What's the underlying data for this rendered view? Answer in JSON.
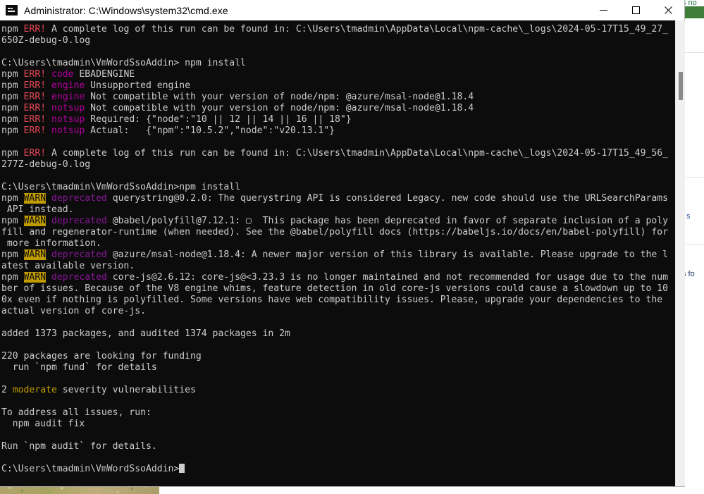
{
  "window": {
    "title": "Administrator:  C:\\Windows\\system32\\cmd.exe",
    "icon": "cmd-icon",
    "minimize_label": "Minimize",
    "maximize_label": "Maximize",
    "close_label": "Close",
    "background_color": "#0c0c0c",
    "text_color": "#cccccc"
  },
  "colors": {
    "error": "#e74856",
    "error_keyword": "#b4009e",
    "warn_background": "#c19c00",
    "deprecated": "#881798",
    "yellow": "#c19c00",
    "foreground": "#cccccc",
    "excel_green": "#217346"
  },
  "background_app": {
    "name": "excel-window",
    "ribbon_title": "s no",
    "cell_text_1": "s",
    "cell_text_2": "s fo"
  },
  "terminal": {
    "prompt_1": "C:\\Users\\tmadmin\\VmWordSsoAddin> npm install",
    "prompt_2": "C:\\Users\\tmadmin\\VmWordSsoAddin>npm install",
    "prompt_final": "C:\\Users\\tmadmin\\VmWordSsoAddin>",
    "cursor": "block-cursor",
    "lines": [
      {
        "type": "err",
        "prefix": "npm ",
        "tag": "ERR!",
        "keyword": "",
        "text": " A complete log of this run can be found in: C:\\Users\\tmadmin\\AppData\\Local\\npm-cache\\_logs\\2024-05-17T15_49_27_"
      },
      {
        "type": "plain",
        "text": "650Z-debug-0.log"
      },
      {
        "type": "blank",
        "text": ""
      },
      {
        "type": "prompt",
        "text": "C:\\Users\\tmadmin\\VmWordSsoAddin> npm install"
      },
      {
        "type": "err",
        "prefix": "npm ",
        "tag": "ERR!",
        "keyword": "code",
        "text": " EBADENGINE"
      },
      {
        "type": "err",
        "prefix": "npm ",
        "tag": "ERR!",
        "keyword": "engine",
        "text": " Unsupported engine"
      },
      {
        "type": "err",
        "prefix": "npm ",
        "tag": "ERR!",
        "keyword": "engine",
        "text": " Not compatible with your version of node/npm: @azure/msal-node@1.18.4"
      },
      {
        "type": "err",
        "prefix": "npm ",
        "tag": "ERR!",
        "keyword": "notsup",
        "text": " Not compatible with your version of node/npm: @azure/msal-node@1.18.4"
      },
      {
        "type": "err",
        "prefix": "npm ",
        "tag": "ERR!",
        "keyword": "notsup",
        "text": " Required: {\"node\":\"10 || 12 || 14 || 16 || 18\"}"
      },
      {
        "type": "err",
        "prefix": "npm ",
        "tag": "ERR!",
        "keyword": "notsup",
        "text": " Actual:   {\"npm\":\"10.5.2\",\"node\":\"v20.13.1\"}"
      },
      {
        "type": "blank",
        "text": ""
      },
      {
        "type": "err",
        "prefix": "npm ",
        "tag": "ERR!",
        "keyword": "",
        "text": " A complete log of this run can be found in: C:\\Users\\tmadmin\\AppData\\Local\\npm-cache\\_logs\\2024-05-17T15_49_56_"
      },
      {
        "type": "plain",
        "text": "277Z-debug-0.log"
      },
      {
        "type": "blank",
        "text": ""
      },
      {
        "type": "prompt",
        "text": "C:\\Users\\tmadmin\\VmWordSsoAddin>npm install"
      },
      {
        "type": "warn",
        "prefix": "npm ",
        "tag": "WARN",
        "keyword": "deprecated",
        "text": " querystring@0.2.0: The querystring API is considered Legacy. new code should use the URLSearchParams"
      },
      {
        "type": "plain",
        "text": " API instead."
      },
      {
        "type": "warn",
        "prefix": "npm ",
        "tag": "WARN",
        "keyword": "deprecated",
        "text": " @babel/polyfill@7.12.1: ▢  This package has been deprecated in favor of separate inclusion of a poly"
      },
      {
        "type": "plain",
        "text": "fill and regenerator-runtime (when needed). See the @babel/polyfill docs (https://babeljs.io/docs/en/babel-polyfill) for"
      },
      {
        "type": "plain",
        "text": " more information."
      },
      {
        "type": "warn",
        "prefix": "npm ",
        "tag": "WARN",
        "keyword": "deprecated",
        "text": " @azure/msal-node@1.18.4: A newer major version of this library is available. Please upgrade to the l"
      },
      {
        "type": "plain",
        "text": "atest available version."
      },
      {
        "type": "warn",
        "prefix": "npm ",
        "tag": "WARN",
        "keyword": "deprecated",
        "text": " core-js@2.6.12: core-js@<3.23.3 is no longer maintained and not recommended for usage due to the num"
      },
      {
        "type": "plain",
        "text": "ber of issues. Because of the V8 engine whims, feature detection in old core-js versions could cause a slowdown up to 10"
      },
      {
        "type": "plain",
        "text": "0x even if nothing is polyfilled. Some versions have web compatibility issues. Please, upgrade your dependencies to the "
      },
      {
        "type": "plain",
        "text": "actual version of core-js."
      },
      {
        "type": "blank",
        "text": ""
      },
      {
        "type": "plain",
        "text": "added 1373 packages, and audited 1374 packages in 2m"
      },
      {
        "type": "blank",
        "text": ""
      },
      {
        "type": "plain",
        "text": "220 packages are looking for funding"
      },
      {
        "type": "plain",
        "text": "  run `npm fund` for details"
      },
      {
        "type": "blank",
        "text": ""
      },
      {
        "type": "vuln",
        "count": "2 ",
        "severity": "moderate",
        "text": " severity vulnerabilities"
      },
      {
        "type": "blank",
        "text": ""
      },
      {
        "type": "plain",
        "text": "To address all issues, run:"
      },
      {
        "type": "plain",
        "text": "  npm audit fix"
      },
      {
        "type": "blank",
        "text": ""
      },
      {
        "type": "plain",
        "text": "Run `npm audit` for details."
      },
      {
        "type": "blank",
        "text": ""
      },
      {
        "type": "prompt-cursor",
        "text": "C:\\Users\\tmadmin\\VmWordSsoAddin>"
      }
    ]
  },
  "scrollbar": {
    "name": "console-scrollbar",
    "thumb_position": "near-top"
  }
}
